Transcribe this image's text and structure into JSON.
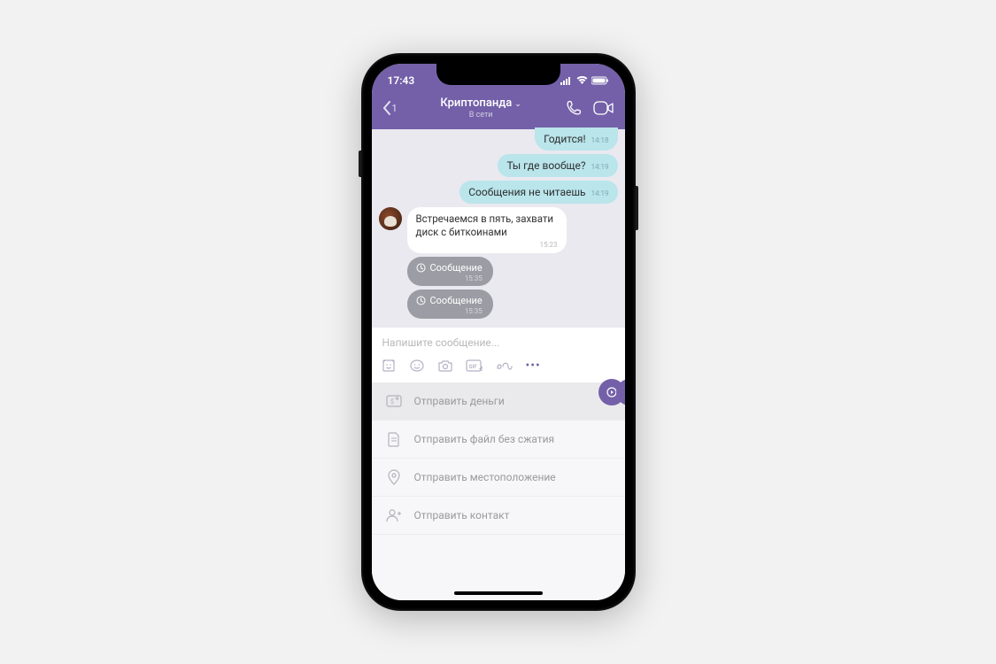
{
  "status": {
    "time": "17:43"
  },
  "header": {
    "back_count": "1",
    "title": "Криптопанда",
    "subtitle": "В сети"
  },
  "messages": {
    "out0": {
      "text": "Годится!",
      "time": "14:18"
    },
    "out1": {
      "text": "Ты где вообще?",
      "time": "14:19"
    },
    "out2": {
      "text": "Сообщения не читаешь",
      "time": "14:19"
    },
    "in0": {
      "text": "Встречаемся в пять, захвати диск с биткоинами",
      "time": "15:23"
    },
    "timed0": {
      "text": "Сообщение",
      "time": "15:35"
    },
    "timed1": {
      "text": "Сообщение",
      "time": "15:35"
    }
  },
  "compose": {
    "placeholder": "Напишите сообщение..."
  },
  "menu": {
    "money": "Отправить деньги",
    "file": "Отправить файл без сжатия",
    "location": "Отправить местоположение",
    "contact": "Отправить контакт"
  }
}
